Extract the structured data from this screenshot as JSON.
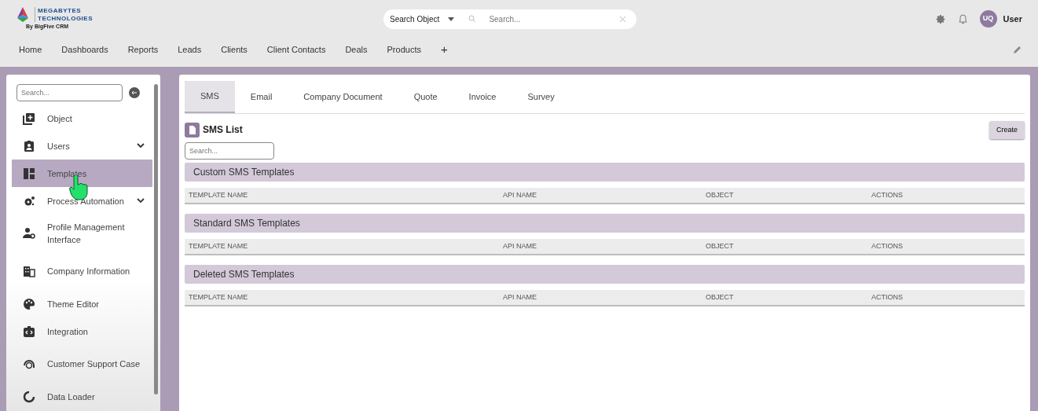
{
  "brand": {
    "name_line1": "MEGABYTES",
    "name_line2": "TECHNOLOGIES",
    "tagline": "By BigFive CRM"
  },
  "search": {
    "object_select": "Search Object",
    "placeholder": "Search..."
  },
  "user": {
    "initials": "UQ",
    "name": "User"
  },
  "nav": [
    {
      "label": "Home"
    },
    {
      "label": "Dashboards"
    },
    {
      "label": "Reports"
    },
    {
      "label": "Leads"
    },
    {
      "label": "Clients"
    },
    {
      "label": "Client Contacts"
    },
    {
      "label": "Deals"
    },
    {
      "label": "Products"
    },
    {
      "label": "+"
    }
  ],
  "sidebar": {
    "search_placeholder": "Search...",
    "items": [
      {
        "label": "Object",
        "selected": false
      },
      {
        "label": "Users",
        "selected": false,
        "expanded": false
      },
      {
        "label": "Templates",
        "selected": true
      },
      {
        "label": "Process Automation",
        "selected": false,
        "expanded": false
      },
      {
        "label": "Profile Management Interface",
        "selected": false
      },
      {
        "label": "Company Information",
        "selected": false
      },
      {
        "label": "Theme Editor",
        "selected": false
      },
      {
        "label": "Integration",
        "selected": false
      },
      {
        "label": "Customer Support Case",
        "selected": false
      },
      {
        "label": "Data Loader",
        "selected": false
      }
    ]
  },
  "tabs": [
    {
      "label": "SMS",
      "selected": true
    },
    {
      "label": "Email",
      "selected": false
    },
    {
      "label": "Company Document",
      "selected": false
    },
    {
      "label": "Quote",
      "selected": false
    },
    {
      "label": "Invoice",
      "selected": false
    },
    {
      "label": "Survey",
      "selected": false
    }
  ],
  "list": {
    "title": "SMS List",
    "create_button": "Create",
    "search_placeholder": "Search...",
    "sections": [
      {
        "title": "Custom SMS Templates",
        "columns": [
          "TEMPLATE NAME",
          "API NAME",
          "OBJECT",
          "ACTIONS"
        ]
      },
      {
        "title": "Standard SMS Templates",
        "columns": [
          "TEMPLATE NAME",
          "API NAME",
          "OBJECT",
          "ACTIONS"
        ]
      },
      {
        "title": "Deleted SMS Templates",
        "columns": [
          "TEMPLATE NAME",
          "API NAME",
          "OBJECT",
          "ACTIONS"
        ]
      }
    ]
  }
}
